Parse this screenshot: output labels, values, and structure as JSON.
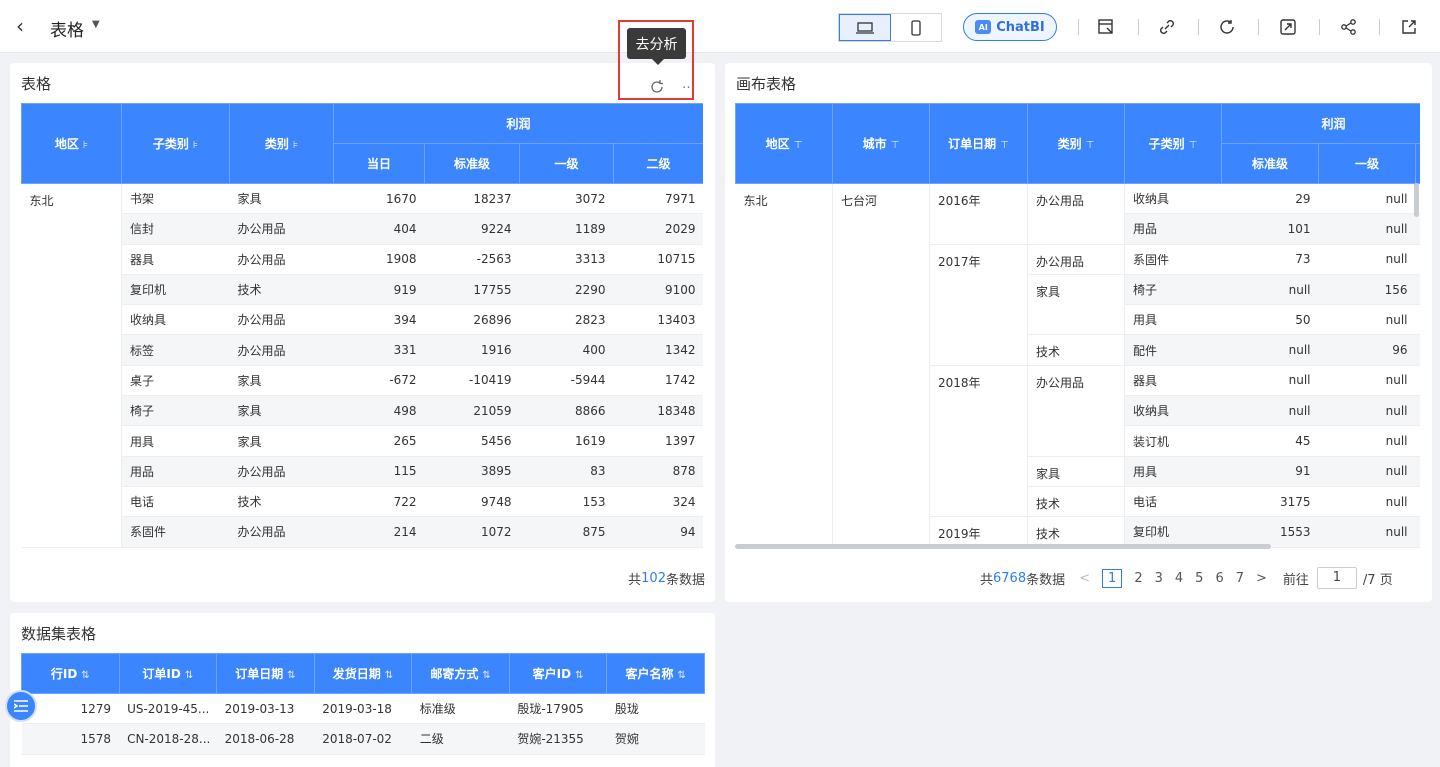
{
  "header": {
    "title": "表格",
    "chatbi_label": "ChatBI",
    "ai_badge": "AI"
  },
  "tooltip": {
    "text": "去分析"
  },
  "card1": {
    "title": "表格",
    "headers": {
      "region": "地区",
      "subcategory": "子类别",
      "category": "类别",
      "profit": "利润",
      "today": "当日",
      "standard": "标准级",
      "first": "一级",
      "second": "二级"
    },
    "region_value": "东北",
    "rows": [
      [
        "书架",
        "家具",
        "1670",
        "18237",
        "3072",
        "7971"
      ],
      [
        "信封",
        "办公用品",
        "404",
        "9224",
        "1189",
        "2029"
      ],
      [
        "器具",
        "办公用品",
        "1908",
        "-2563",
        "3313",
        "10715"
      ],
      [
        "复印机",
        "技术",
        "919",
        "17755",
        "2290",
        "9100"
      ],
      [
        "收纳具",
        "办公用品",
        "394",
        "26896",
        "2823",
        "13403"
      ],
      [
        "标签",
        "办公用品",
        "331",
        "1916",
        "400",
        "1342"
      ],
      [
        "桌子",
        "家具",
        "-672",
        "-10419",
        "-5944",
        "1742"
      ],
      [
        "椅子",
        "家具",
        "498",
        "21059",
        "8866",
        "18348"
      ],
      [
        "用具",
        "家具",
        "265",
        "5456",
        "1619",
        "1397"
      ],
      [
        "用品",
        "办公用品",
        "115",
        "3895",
        "83",
        "878"
      ],
      [
        "电话",
        "技术",
        "722",
        "9748",
        "153",
        "324"
      ],
      [
        "系固件",
        "办公用品",
        "214",
        "1072",
        "875",
        "94"
      ]
    ],
    "footer": {
      "prefix": "共",
      "count": "102",
      "suffix": "条数据"
    }
  },
  "card2": {
    "title": "画布表格",
    "headers": {
      "region": "地区",
      "city": "城市",
      "order_date": "订单日期",
      "category": "类别",
      "subcategory": "子类别",
      "profit": "利润",
      "standard": "标准级",
      "first": "一级"
    },
    "region_value": "东北",
    "city_value": "七台河",
    "rows": [
      {
        "year": "2016年",
        "cat": "办公用品",
        "sub": "收纳具",
        "std": "29",
        "first": "null"
      },
      {
        "year": "",
        "cat": "",
        "sub": "用品",
        "std": "101",
        "first": "null"
      },
      {
        "year": "2017年",
        "cat": "办公用品",
        "sub": "系固件",
        "std": "73",
        "first": "null"
      },
      {
        "year": "",
        "cat": "家具",
        "sub": "椅子",
        "std": "null",
        "first": "156"
      },
      {
        "year": "",
        "cat": "",
        "sub": "用具",
        "std": "50",
        "first": "null"
      },
      {
        "year": "",
        "cat": "技术",
        "sub": "配件",
        "std": "null",
        "first": "96"
      },
      {
        "year": "2018年",
        "cat": "办公用品",
        "sub": "器具",
        "std": "null",
        "first": "null"
      },
      {
        "year": "",
        "cat": "",
        "sub": "收纳具",
        "std": "null",
        "first": "null"
      },
      {
        "year": "",
        "cat": "",
        "sub": "装订机",
        "std": "45",
        "first": "null"
      },
      {
        "year": "",
        "cat": "家具",
        "sub": "用具",
        "std": "91",
        "first": "null"
      },
      {
        "year": "",
        "cat": "技术",
        "sub": "电话",
        "std": "3175",
        "first": "null"
      },
      {
        "year": "2019年",
        "cat": "技术",
        "sub": "复印机",
        "std": "1553",
        "first": "null"
      }
    ],
    "pager": {
      "prefix": "共",
      "count": "6768",
      "suffix": "条数据",
      "prev": "<",
      "pages": [
        "1",
        "2",
        "3",
        "4",
        "5",
        "6",
        "7"
      ],
      "next": ">",
      "goto_label": "前往",
      "goto_value": "1",
      "total_pages": "/7 页"
    }
  },
  "card3": {
    "title": "数据集表格",
    "headers": [
      "行ID",
      "订单ID",
      "订单日期",
      "发货日期",
      "邮寄方式",
      "客户ID",
      "客户名称"
    ],
    "rows": [
      [
        "1279",
        "US-2019-45...",
        "2019-03-13",
        "2019-03-18",
        "标准级",
        "殷珑-17905",
        "殷珑"
      ],
      [
        "1578",
        "CN-2018-28...",
        "2018-06-28",
        "2018-07-02",
        "二级",
        "贺婉-21355",
        "贺婉"
      ]
    ]
  },
  "colors": {
    "accent": "#3b86ff",
    "highlight": "#e53935"
  }
}
